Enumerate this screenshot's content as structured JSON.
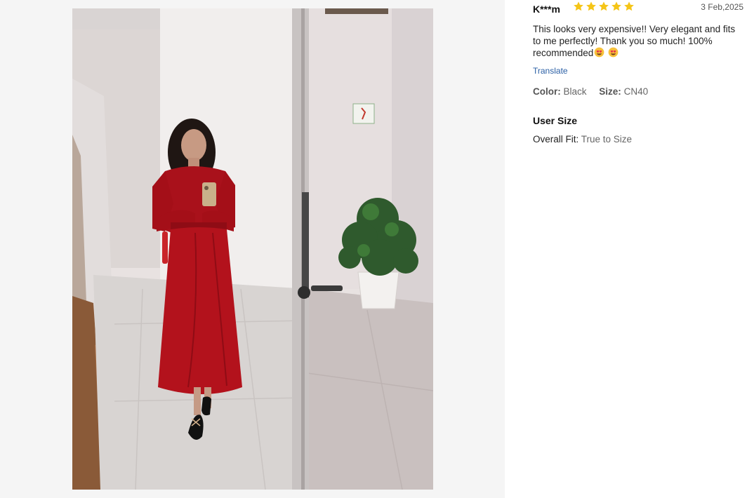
{
  "review": {
    "author": "K***m",
    "rating": 5,
    "rating_max": 5,
    "date": "3 Feb,2025",
    "text": "This looks very expensive!! Very elegant and fits to me perfectly! Thank you so much! 100% recommended",
    "emojis": [
      "smiling-face-with-heart-eyes",
      "smiling-face-with-heart-eyes"
    ],
    "translate_label": "Translate",
    "attributes": [
      {
        "label": "Color:",
        "value": "Black"
      },
      {
        "label": "Size:",
        "value": "CN40"
      }
    ],
    "user_size": {
      "title": "User Size",
      "fit_label": "Overall Fit:",
      "fit_value": "True to Size"
    }
  },
  "colors": {
    "star": "#f5c518",
    "link": "#2a5fa5",
    "dress": "#b3121c"
  },
  "photo": {
    "description_icon": "review-photo"
  }
}
